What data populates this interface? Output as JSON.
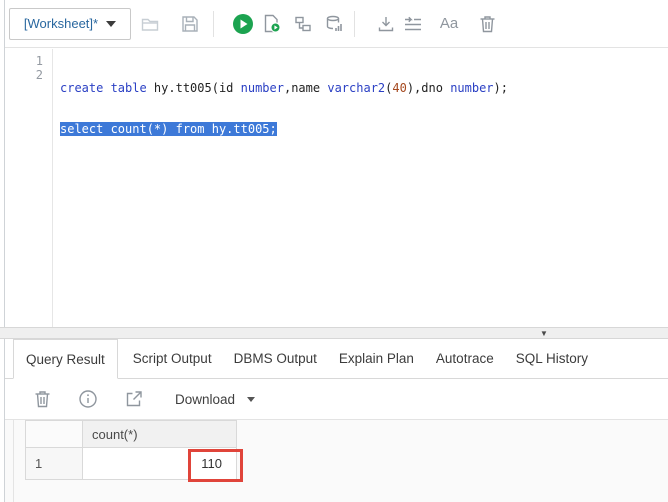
{
  "toolbar": {
    "worksheet_label": "[Worksheet]*",
    "aa_label": "Aa",
    "icon_names": [
      "open-folder-icon",
      "save-icon",
      "run-statement-icon",
      "run-script-icon",
      "explain-plan-icon",
      "autotrace-icon",
      "download-editor-icon",
      "format-icon",
      "font-size-icon",
      "clear-icon"
    ]
  },
  "editor": {
    "lines": [
      {
        "number": "1",
        "tokens": {
          "t0": "create table ",
          "t1": "hy.tt005(id ",
          "t2": "number",
          "t3": ",name ",
          "t4": "varchar2",
          "t5": "(",
          "t6": "40",
          "t7": "),dno ",
          "t8": "number",
          "t9": ");"
        }
      },
      {
        "number": "2",
        "selected_text": "select count(*) from hy.tt005;"
      }
    ]
  },
  "result_panel": {
    "tabs": [
      {
        "label": "Query Result",
        "active": true
      },
      {
        "label": "Script Output",
        "active": false
      },
      {
        "label": "DBMS Output",
        "active": false
      },
      {
        "label": "Explain Plan",
        "active": false
      },
      {
        "label": "Autotrace",
        "active": false
      },
      {
        "label": "SQL History",
        "active": false
      }
    ],
    "toolbar": {
      "download_label": "Download",
      "icon_names": [
        "delete-result-icon",
        "info-icon",
        "open-in-new-icon",
        "download-caret-icon"
      ]
    },
    "grid": {
      "columns": [
        "count(*)"
      ],
      "rows": [
        {
          "num": "1",
          "values": [
            "110"
          ]
        }
      ]
    },
    "annotation": {
      "highlighted_value": "110"
    }
  },
  "colors": {
    "accent_green": "#1ca350",
    "selection_blue": "#3d79d8",
    "keyword_blue": "#2b40c4",
    "number_literal": "#a5491f",
    "annotation_red": "#e0443a",
    "worksheet_label_blue": "#29679f"
  }
}
